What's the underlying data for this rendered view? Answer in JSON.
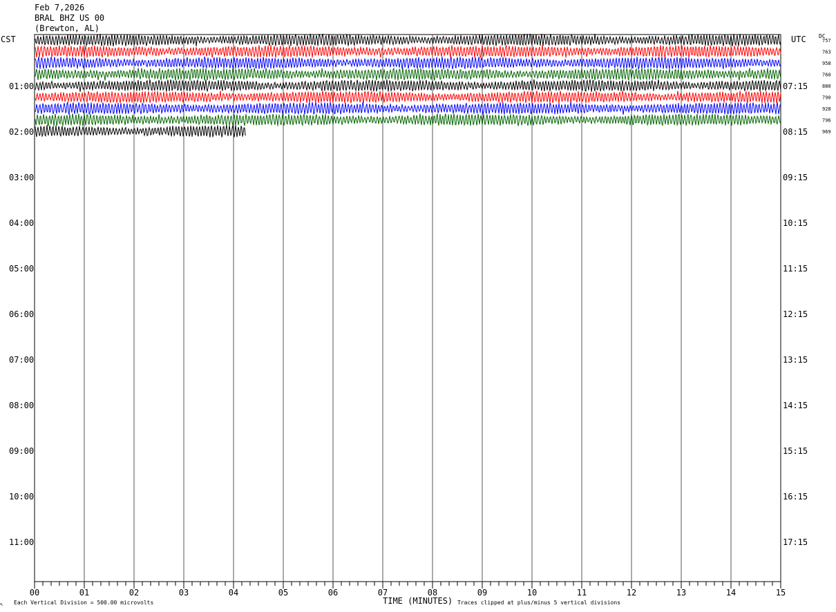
{
  "header": {
    "date": "Feb 7,2026",
    "station": "BRAL BHZ US 00",
    "location": "(Brewton, AL)"
  },
  "left_axis_title": "CST",
  "right_axis_title": "UTC",
  "dc_title": "DC",
  "footer": {
    "scale_note": "Each Vertical Division =  500.00 microvolts",
    "xlabel": "TIME (MINUTES)",
    "clip_note": "Traces clipped at plus/minus 5 vertical divisions",
    "corner_mark": "↖"
  },
  "chart_data": {
    "type": "line",
    "title": "",
    "xlabel": "TIME (MINUTES)",
    "xlim": [
      0,
      15
    ],
    "x_ticks": [
      "00",
      "01",
      "02",
      "03",
      "04",
      "05",
      "06",
      "07",
      "08",
      "09",
      "10",
      "11",
      "12",
      "13",
      "14",
      "15"
    ],
    "hour_labels_cst": [
      "01:00",
      "02:00",
      "03:00",
      "04:00",
      "05:00",
      "06:00",
      "07:00",
      "08:00",
      "09:00",
      "10:00",
      "11:00"
    ],
    "hour_labels_utc": [
      "07:15",
      "08:15",
      "09:15",
      "10:15",
      "11:15",
      "12:15",
      "13:15",
      "14:15",
      "15:15",
      "16:15",
      "17:15"
    ],
    "rows_per_hour": 4,
    "trace_colors": [
      "#000000",
      "#ff0000",
      "#0000ff",
      "#006400"
    ],
    "dc_offsets": [
      "757",
      "763",
      "958",
      "760",
      "880",
      "790",
      "928",
      "796",
      "969"
    ],
    "traces_end_minutes": [
      15,
      15,
      15,
      15,
      15,
      15,
      15,
      15,
      4.25
    ]
  }
}
